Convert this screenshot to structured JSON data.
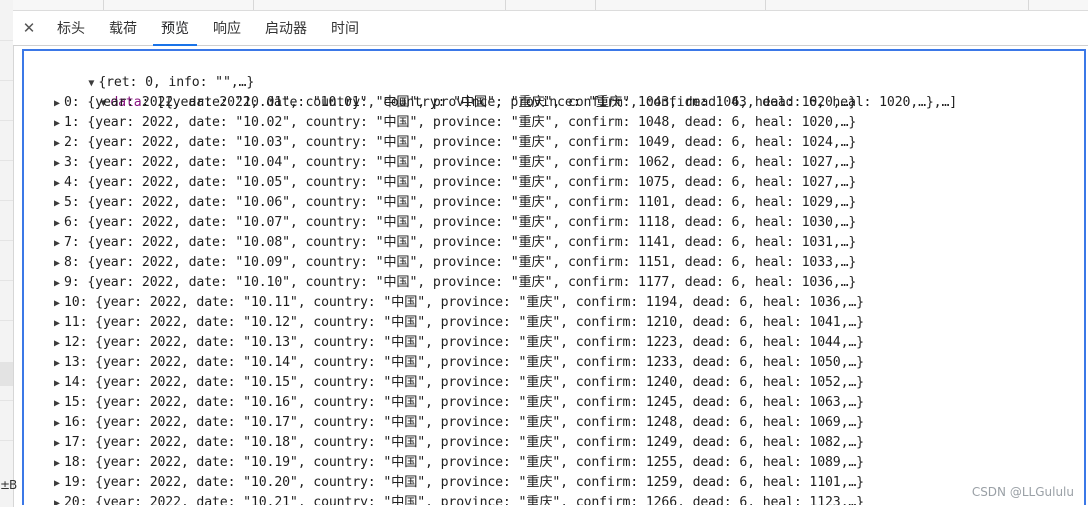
{
  "tabs": {
    "close_label": "✕",
    "items": [
      "标头",
      "载荷",
      "预览",
      "响应",
      "启动器",
      "时间"
    ],
    "active_index": 2
  },
  "left_fragment": "±B",
  "preview": {
    "root_line": "{ret: 0, info: \"\",…}",
    "data_key": "data",
    "data_summary": ": [{year: 2022, date: \"10.01\", country: \"中国\", province: \"重庆\", confirm: 1043, dead: 6, heal: 1020,…},…]",
    "rows": [
      {
        "index": "0",
        "text": ": {year: 2022, date: \"10.01\", country: \"中国\", province: \"重庆\", confirm: 1043, dead: 6, heal: 1020,…}"
      },
      {
        "index": "1",
        "text": ": {year: 2022, date: \"10.02\", country: \"中国\", province: \"重庆\", confirm: 1048, dead: 6, heal: 1020,…}"
      },
      {
        "index": "2",
        "text": ": {year: 2022, date: \"10.03\", country: \"中国\", province: \"重庆\", confirm: 1049, dead: 6, heal: 1024,…}"
      },
      {
        "index": "3",
        "text": ": {year: 2022, date: \"10.04\", country: \"中国\", province: \"重庆\", confirm: 1062, dead: 6, heal: 1027,…}"
      },
      {
        "index": "4",
        "text": ": {year: 2022, date: \"10.05\", country: \"中国\", province: \"重庆\", confirm: 1075, dead: 6, heal: 1027,…}"
      },
      {
        "index": "5",
        "text": ": {year: 2022, date: \"10.06\", country: \"中国\", province: \"重庆\", confirm: 1101, dead: 6, heal: 1029,…}"
      },
      {
        "index": "6",
        "text": ": {year: 2022, date: \"10.07\", country: \"中国\", province: \"重庆\", confirm: 1118, dead: 6, heal: 1030,…}"
      },
      {
        "index": "7",
        "text": ": {year: 2022, date: \"10.08\", country: \"中国\", province: \"重庆\", confirm: 1141, dead: 6, heal: 1031,…}"
      },
      {
        "index": "8",
        "text": ": {year: 2022, date: \"10.09\", country: \"中国\", province: \"重庆\", confirm: 1151, dead: 6, heal: 1033,…}"
      },
      {
        "index": "9",
        "text": ": {year: 2022, date: \"10.10\", country: \"中国\", province: \"重庆\", confirm: 1177, dead: 6, heal: 1036,…}"
      },
      {
        "index": "10",
        "text": ": {year: 2022, date: \"10.11\", country: \"中国\", province: \"重庆\", confirm: 1194, dead: 6, heal: 1036,…}"
      },
      {
        "index": "11",
        "text": ": {year: 2022, date: \"10.12\", country: \"中国\", province: \"重庆\", confirm: 1210, dead: 6, heal: 1041,…}"
      },
      {
        "index": "12",
        "text": ": {year: 2022, date: \"10.13\", country: \"中国\", province: \"重庆\", confirm: 1223, dead: 6, heal: 1044,…}"
      },
      {
        "index": "13",
        "text": ": {year: 2022, date: \"10.14\", country: \"中国\", province: \"重庆\", confirm: 1233, dead: 6, heal: 1050,…}"
      },
      {
        "index": "14",
        "text": ": {year: 2022, date: \"10.15\", country: \"中国\", province: \"重庆\", confirm: 1240, dead: 6, heal: 1052,…}"
      },
      {
        "index": "15",
        "text": ": {year: 2022, date: \"10.16\", country: \"中国\", province: \"重庆\", confirm: 1245, dead: 6, heal: 1063,…}"
      },
      {
        "index": "16",
        "text": ": {year: 2022, date: \"10.17\", country: \"中国\", province: \"重庆\", confirm: 1248, dead: 6, heal: 1069,…}"
      },
      {
        "index": "17",
        "text": ": {year: 2022, date: \"10.18\", country: \"中国\", province: \"重庆\", confirm: 1249, dead: 6, heal: 1082,…}"
      },
      {
        "index": "18",
        "text": ": {year: 2022, date: \"10.19\", country: \"中国\", province: \"重庆\", confirm: 1255, dead: 6, heal: 1089,…}"
      },
      {
        "index": "19",
        "text": ": {year: 2022, date: \"10.20\", country: \"中国\", province: \"重庆\", confirm: 1259, dead: 6, heal: 1101,…}"
      },
      {
        "index": "20",
        "text": ": {year: 2022, date: \"10.21\", country: \"中国\", province: \"重庆\", confirm: 1266, dead: 6, heal: 1123,…}"
      }
    ]
  },
  "watermark": "CSDN @LLGululu"
}
